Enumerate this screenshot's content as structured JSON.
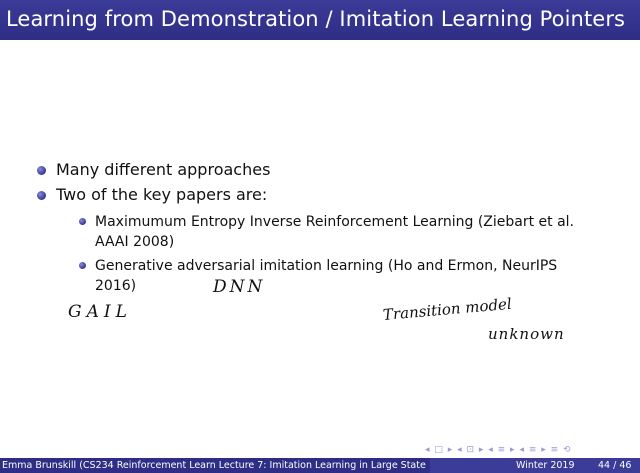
{
  "slide": {
    "title": "Learning from Demonstration / Imitation Learning Pointers",
    "bullets": [
      {
        "text": "Many different approaches"
      },
      {
        "text": "Two of the key papers are:"
      }
    ],
    "sub_bullets": [
      {
        "line1": "Maximumum Entropy Inverse Reinforcement Learning (Ziebart et al.",
        "line2": "AAAI 2008)"
      },
      {
        "line1": "Generative adversarial imitation learning (Ho and Ermon, NeurIPS",
        "line2": "2016)"
      }
    ],
    "handwriting": {
      "dnn": "DNN",
      "gail": "GAIL",
      "transition": "Transition model",
      "unknown": "unknown"
    }
  },
  "nav_symbols": "◂ □ ▸ ◂ ⊡ ▸ ◂ ≡ ▸ ◂ ≡ ▸ ≡ ⟲",
  "footer": {
    "author_title": "Emma Brunskill (CS234 Reinforcement Learn Lecture 7: Imitation Learning in Large State",
    "date": "Winter 2019",
    "page": "44 / 46"
  },
  "colors": {
    "accent": "#3b3b98",
    "footer_bg": "#2e2e86"
  }
}
